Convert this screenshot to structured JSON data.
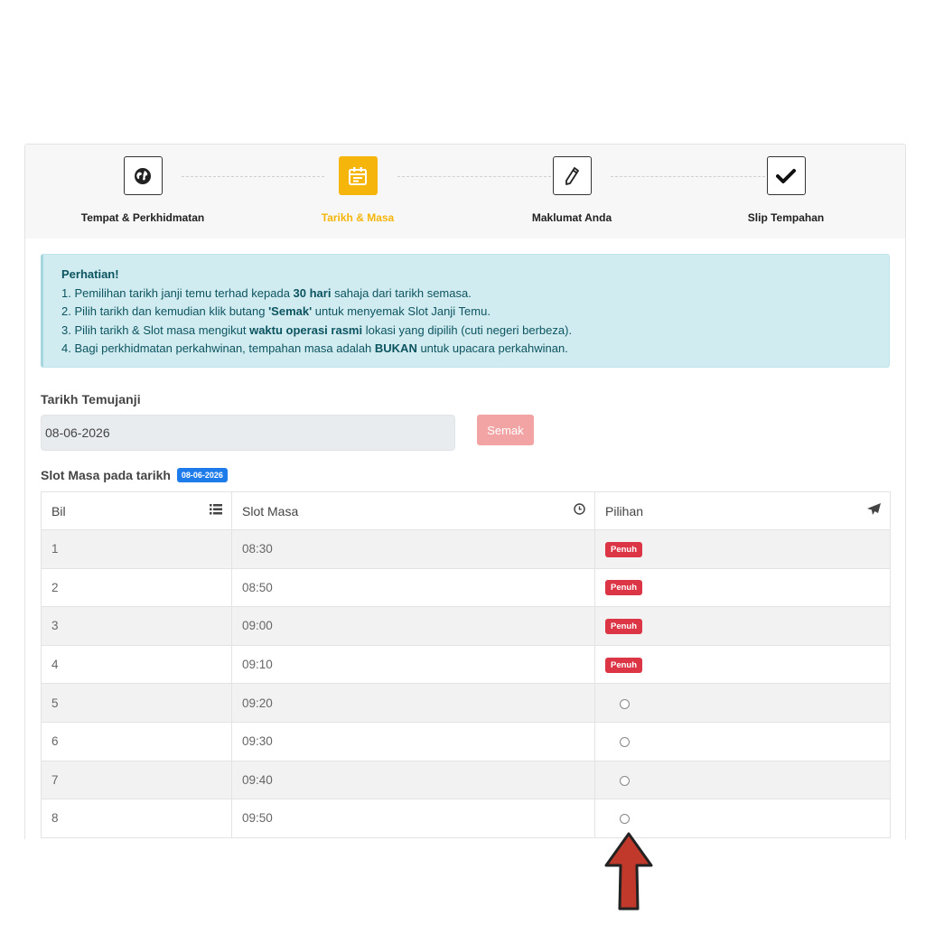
{
  "steps": [
    {
      "label": "Tempat & Perkhidmatan",
      "icon": "globe-icon",
      "active": false
    },
    {
      "label": "Tarikh & Masa",
      "icon": "calendar-icon",
      "active": true
    },
    {
      "label": "Maklumat Anda",
      "icon": "pencil-icon",
      "active": false
    },
    {
      "label": "Slip Tempahan",
      "icon": "check-icon",
      "active": false
    }
  ],
  "alert": {
    "title": "Perhatian!",
    "lines": [
      {
        "pre": "1. Pemilihan tarikh janji temu terhad kepada ",
        "bold": "30 hari",
        "post": " sahaja dari tarikh semasa."
      },
      {
        "pre": "2. Pilih tarikh dan kemudian klik butang ",
        "bold": "'Semak'",
        "post": " untuk menyemak Slot Janji Temu."
      },
      {
        "pre": "3. Pilih tarikh & Slot masa mengikut ",
        "bold": "waktu operasi rasmi",
        "post": " lokasi yang dipilih (cuti negeri berbeza)."
      },
      {
        "pre": "4. Bagi perkhidmatan perkahwinan, tempahan masa adalah ",
        "bold": "BUKAN",
        "post": " untuk upacara perkahwinan."
      }
    ]
  },
  "form": {
    "date_label": "Tarikh Temujanji",
    "date_value": "08-06-2026",
    "check_button": "Semak"
  },
  "slots": {
    "title": "Slot Masa pada tarikh",
    "date_badge": "08-06-2026",
    "headers": {
      "bil": "Bil",
      "slot": "Slot Masa",
      "pilihan": "Pilihan"
    },
    "full_label": "Penuh",
    "rows": [
      {
        "bil": "1",
        "time": "08:30",
        "full": true
      },
      {
        "bil": "2",
        "time": "08:50",
        "full": true
      },
      {
        "bil": "3",
        "time": "09:00",
        "full": true
      },
      {
        "bil": "4",
        "time": "09:10",
        "full": true
      },
      {
        "bil": "5",
        "time": "09:20",
        "full": false
      },
      {
        "bil": "6",
        "time": "09:30",
        "full": false
      },
      {
        "bil": "7",
        "time": "09:40",
        "full": false
      },
      {
        "bil": "8",
        "time": "09:50",
        "full": false
      }
    ]
  },
  "colors": {
    "accent": "#f5b50a",
    "alert_bg": "#d1ecf1",
    "danger": "#dc3545",
    "primary": "#1e7bea",
    "arrow": "#c0392b"
  }
}
